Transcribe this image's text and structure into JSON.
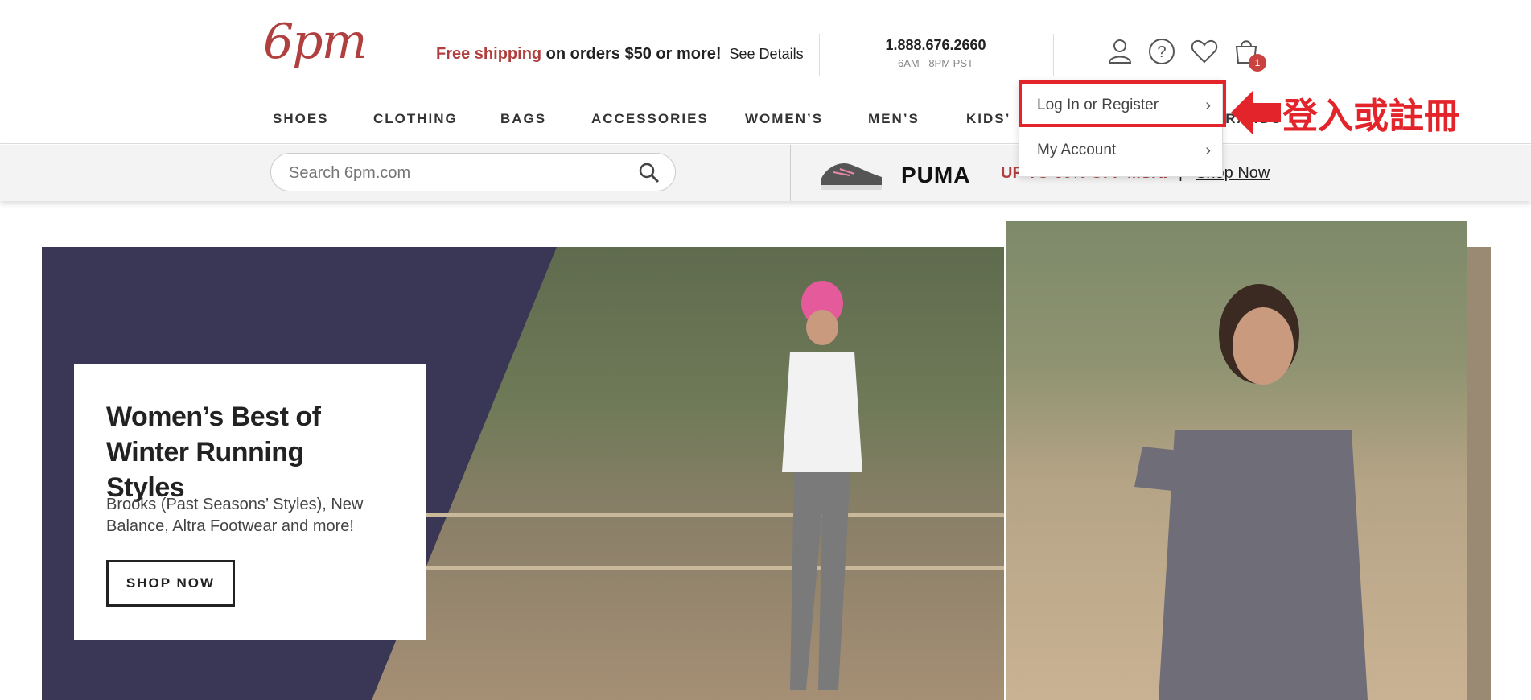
{
  "header": {
    "logo": "6pm",
    "promo_red": "Free shipping",
    "promo_text": " on orders $50 or more!",
    "promo_link": "See Details",
    "phone": "1.888.676.2660",
    "hours": "6AM - 8PM PST",
    "cart_count": "1"
  },
  "nav": {
    "items": [
      "SHOES",
      "CLOTHING",
      "BAGS",
      "ACCESSORIES",
      "WOMEN’S",
      "MEN’S",
      "KIDS’",
      "BRANDS"
    ]
  },
  "search": {
    "placeholder": "Search 6pm.com"
  },
  "promo_bar": {
    "brand": "PUMA",
    "text": "UP TO 60% OFF MSRP",
    "link": "Shop Now"
  },
  "account_dropdown": {
    "items": [
      "Log In or Register",
      "My Account"
    ]
  },
  "annotation": {
    "text": "登入或註冊"
  },
  "hero": {
    "title": "Women’s Best of Winter Running Styles",
    "description": "Brooks (Past Seasons’ Styles), New Balance, Altra Footwear and more!",
    "button": "SHOP NOW"
  },
  "colors": {
    "brand_red": "#b0403f",
    "annotation_red": "#e3242b",
    "hero_navy": "#3a3656"
  }
}
